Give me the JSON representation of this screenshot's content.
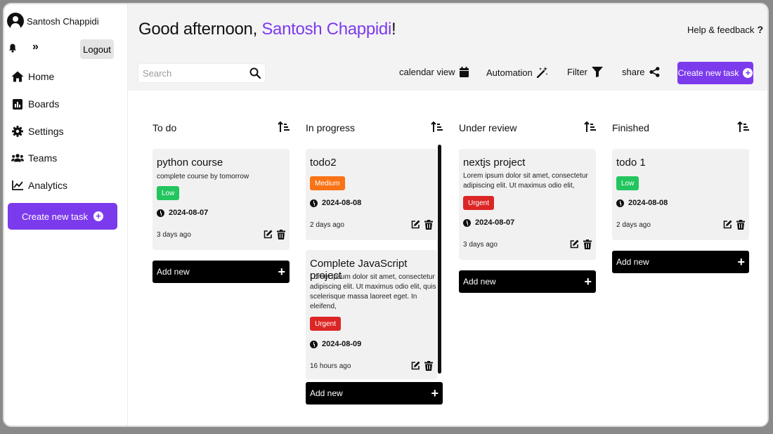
{
  "sidebar": {
    "user_name": "Santosh Chappidi",
    "logout_label": "Logout",
    "expand_glyph": "»",
    "nav": [
      {
        "label": "Home",
        "icon": "home-icon"
      },
      {
        "label": "Boards",
        "icon": "chart-icon"
      },
      {
        "label": "Settings",
        "icon": "gear-icon"
      },
      {
        "label": "Teams",
        "icon": "users-icon"
      },
      {
        "label": "Analytics",
        "icon": "analytics-icon"
      }
    ],
    "create_label": "Create new task"
  },
  "header": {
    "greeting_prefix": "Good afternoon, ",
    "greeting_name": "Santosh Chappidi",
    "greeting_suffix": "!",
    "help_label": "Help & feedback",
    "help_icon": "?",
    "search_placeholder": "Search",
    "toolbar": {
      "calendar": "calendar view",
      "automation": "Automation",
      "filter": "Filter",
      "share": "share",
      "create": "Create new task"
    }
  },
  "colors": {
    "accent": "#7c3aed",
    "low": "#22c55e",
    "medium": "#f97316",
    "urgent": "#dc2626",
    "header_bg": "#f3f3f4"
  },
  "columns": [
    {
      "title": "To do",
      "add_label": "Add new",
      "cards": [
        {
          "title": "python course",
          "description": "complete course by tomorrow",
          "priority": "Low",
          "date": "2024-08-07",
          "ago": "3 days ago"
        }
      ]
    },
    {
      "title": "In progress",
      "add_label": "Add new",
      "cards": [
        {
          "title": "todo2",
          "description": "",
          "priority": "Medium",
          "date": "2024-08-08",
          "ago": "2 days ago"
        },
        {
          "title": "Complete JavaScript project",
          "description": "Lorem ipsum dolor sit amet, consectetur adipiscing elit. Ut maximus odio elit, quis scelerisque massa laoreet eget. In eleifend,",
          "priority": "Urgent",
          "date": "2024-08-09",
          "ago": "16 hours ago"
        }
      ]
    },
    {
      "title": "Under review",
      "add_label": "Add new",
      "cards": [
        {
          "title": "nextjs project",
          "description": "Lorem ipsum dolor sit amet, consectetur adipiscing elit. Ut maximus odio elit,",
          "priority": "Urgent",
          "date": "2024-08-07",
          "ago": "3 days ago"
        }
      ]
    },
    {
      "title": "Finished",
      "add_label": "Add new",
      "cards": [
        {
          "title": "todo 1",
          "description": "",
          "priority": "Low",
          "date": "2024-08-08",
          "ago": "2 days ago"
        }
      ]
    }
  ]
}
